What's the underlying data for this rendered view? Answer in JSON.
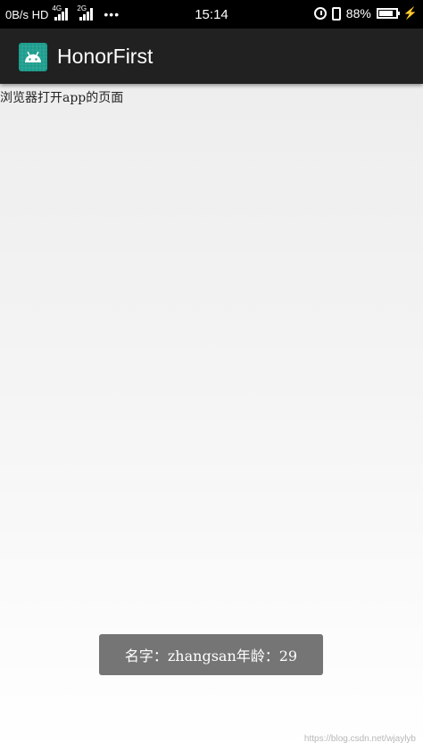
{
  "status_bar": {
    "network_speed": "0B/s HD",
    "signal1_tag": "4G",
    "signal2_tag": "2G",
    "more": "•••",
    "time": "15:14",
    "battery_percent": "88%",
    "battery_level": 0.88,
    "icons": [
      "alarm-icon",
      "vibrate-icon",
      "battery-icon",
      "charging-bolt-icon"
    ]
  },
  "toolbar": {
    "title": "HonorFirst",
    "background": "#212121",
    "icon": "android-launcher-icon",
    "icon_color": "#1a9c8c"
  },
  "content": {
    "text": "浏览器打开app的页面"
  },
  "toast": {
    "message": "名字：zhangsan年龄：29",
    "background": "#757575"
  },
  "watermark": {
    "text": "https://blog.csdn.net/wjaylyb"
  }
}
